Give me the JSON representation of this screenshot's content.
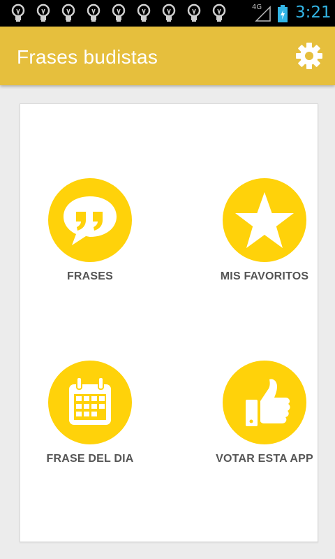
{
  "status_bar": {
    "network": "4G",
    "time": "3:21",
    "notification_icons": [
      "lightbulb-icon",
      "lightbulb-icon",
      "lightbulb-icon",
      "lightbulb-icon",
      "lightbulb-icon",
      "lightbulb-icon",
      "lightbulb-icon",
      "lightbulb-icon",
      "lightbulb-icon"
    ]
  },
  "action_bar": {
    "title": "Frases budistas",
    "settings_icon": "gear-icon",
    "color": "#e6bf3d"
  },
  "menu": {
    "accent_color": "#ffd20a",
    "items": [
      {
        "label": "FRASES",
        "icon": "quote-bubble-icon"
      },
      {
        "label": "MIS FAVORITOS",
        "icon": "star-icon"
      },
      {
        "label": "FRASE DEL DIA",
        "icon": "calendar-icon"
      },
      {
        "label": "VOTAR ESTA APP",
        "icon": "thumbs-up-icon"
      }
    ]
  }
}
